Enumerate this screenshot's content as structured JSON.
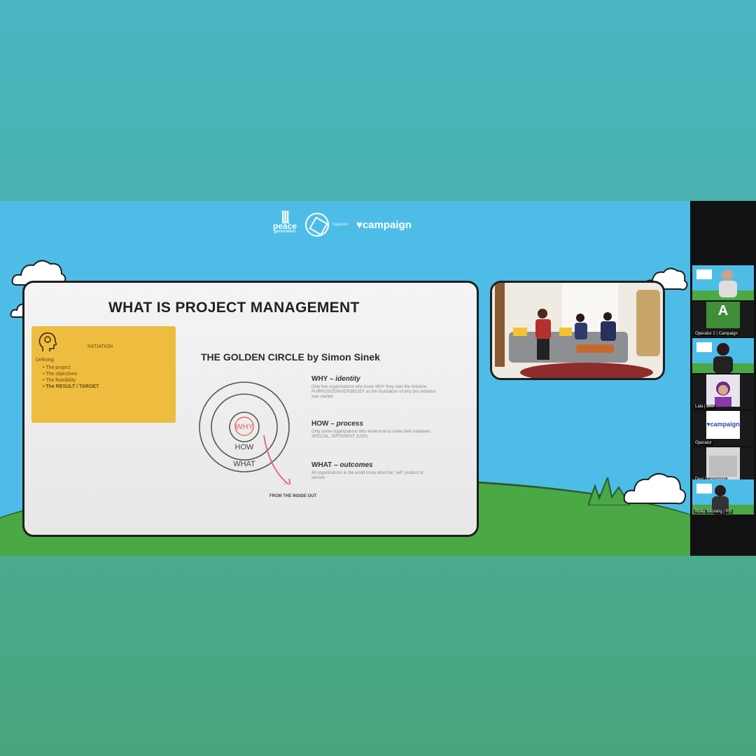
{
  "header_logos": {
    "logo1": "peace",
    "logo1_sub": "generation",
    "logo2_sub": "Yayasan",
    "logo3": "♥campaign"
  },
  "slide": {
    "title": "WHAT IS PROJECT MANAGEMENT",
    "initiation": {
      "icon": "head-lightbulb-icon",
      "title": "INITIATION",
      "intro": "Defining:",
      "items": [
        "The project",
        "The objectives",
        "The feasibility"
      ],
      "result_item": "The RESULT / TARGET"
    },
    "golden_circle": {
      "title": "THE GOLDEN CIRCLE by Simon Sinek",
      "ring_labels": [
        "WHY",
        "HOW",
        "WHAT"
      ],
      "arrow_caption": "FROM THE INSIDE OUT"
    },
    "notes": [
      {
        "heading": "WHY –",
        "emph": "identity",
        "body": "Only few organizations who know WHY they start the initiative. PURPOSE/DRIVER/BELIEF as the foundation of why this initiative was started"
      },
      {
        "heading": "HOW –",
        "emph": "process",
        "body": "Only some organizations who know how to make their initiatives SPECIAL, DIFFERENT (USP)"
      },
      {
        "heading": "WHAT –",
        "emph": "outcomes",
        "body": "All organizations in the world know what the \"sell\" product or service"
      }
    ]
  },
  "participants": [
    {
      "name": "",
      "kind": "video-avatar"
    },
    {
      "name": "Operator 2 | Campaign",
      "kind": "initial",
      "initial": "A",
      "color": "#3f8f3a"
    },
    {
      "name": "",
      "kind": "video-avatar"
    },
    {
      "name": "Lala | BKP",
      "kind": "video-avatar"
    },
    {
      "name": "Operator",
      "kind": "brand",
      "brand": "♥campaign"
    },
    {
      "name": "Devi | Campaign",
      "kind": "video-avatar"
    },
    {
      "name": "Rizky Sitorang | PG",
      "kind": "video-avatar"
    }
  ],
  "colors": {
    "sky": "#4dbde8",
    "grass": "#4aa845",
    "initiation_box": "#eebc3f",
    "why_text": "#e06a5a",
    "arrow": "#e85a8a"
  }
}
